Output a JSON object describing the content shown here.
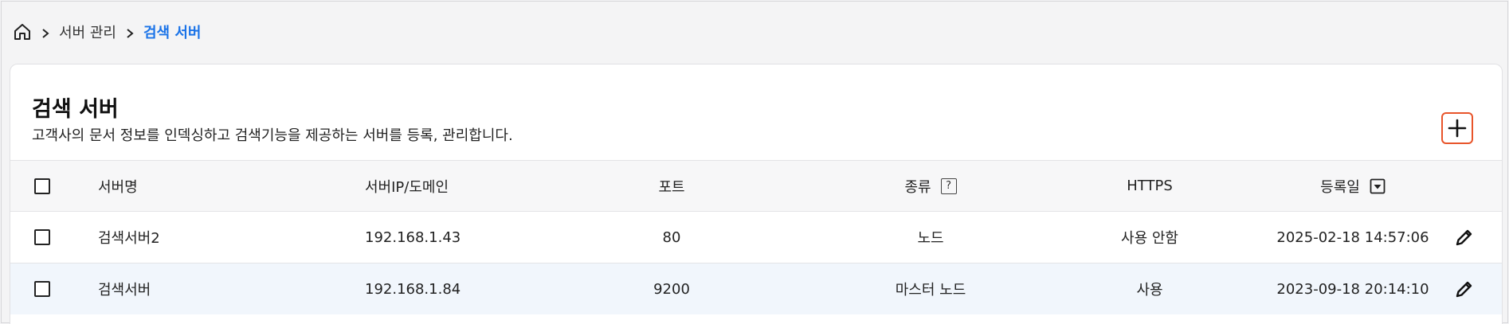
{
  "breadcrumb": {
    "items": [
      "서버 관리",
      "검색 서버"
    ]
  },
  "page": {
    "title": "검색 서버",
    "description": "고객사의 문서 정보를 인덱싱하고 검색기능을 제공하는 서버를 등록, 관리합니다."
  },
  "colors": {
    "accent": "#1a73e8",
    "add_button_border": "#e8542a",
    "row_highlight": "#f1f6fc"
  },
  "table": {
    "columns": {
      "name": "서버명",
      "ip": "서버IP/도메인",
      "port": "포트",
      "type": "종류",
      "type_help": "?",
      "https": "HTTPS",
      "date": "등록일"
    },
    "rows": [
      {
        "name": "검색서버2",
        "ip": "192.168.1.43",
        "port": "80",
        "type": "노드",
        "https": "사용 안함",
        "date": "2025-02-18 14:57:06"
      },
      {
        "name": "검색서버",
        "ip": "192.168.1.84",
        "port": "9200",
        "type": "마스터 노드",
        "https": "사용",
        "date": "2023-09-18 20:14:10"
      }
    ]
  },
  "icons": {
    "home": "home-icon",
    "separator": "chevron-right-icon",
    "add": "plus-icon",
    "sort": "sort-down-icon",
    "edit": "pencil-icon",
    "help": "question-icon"
  }
}
